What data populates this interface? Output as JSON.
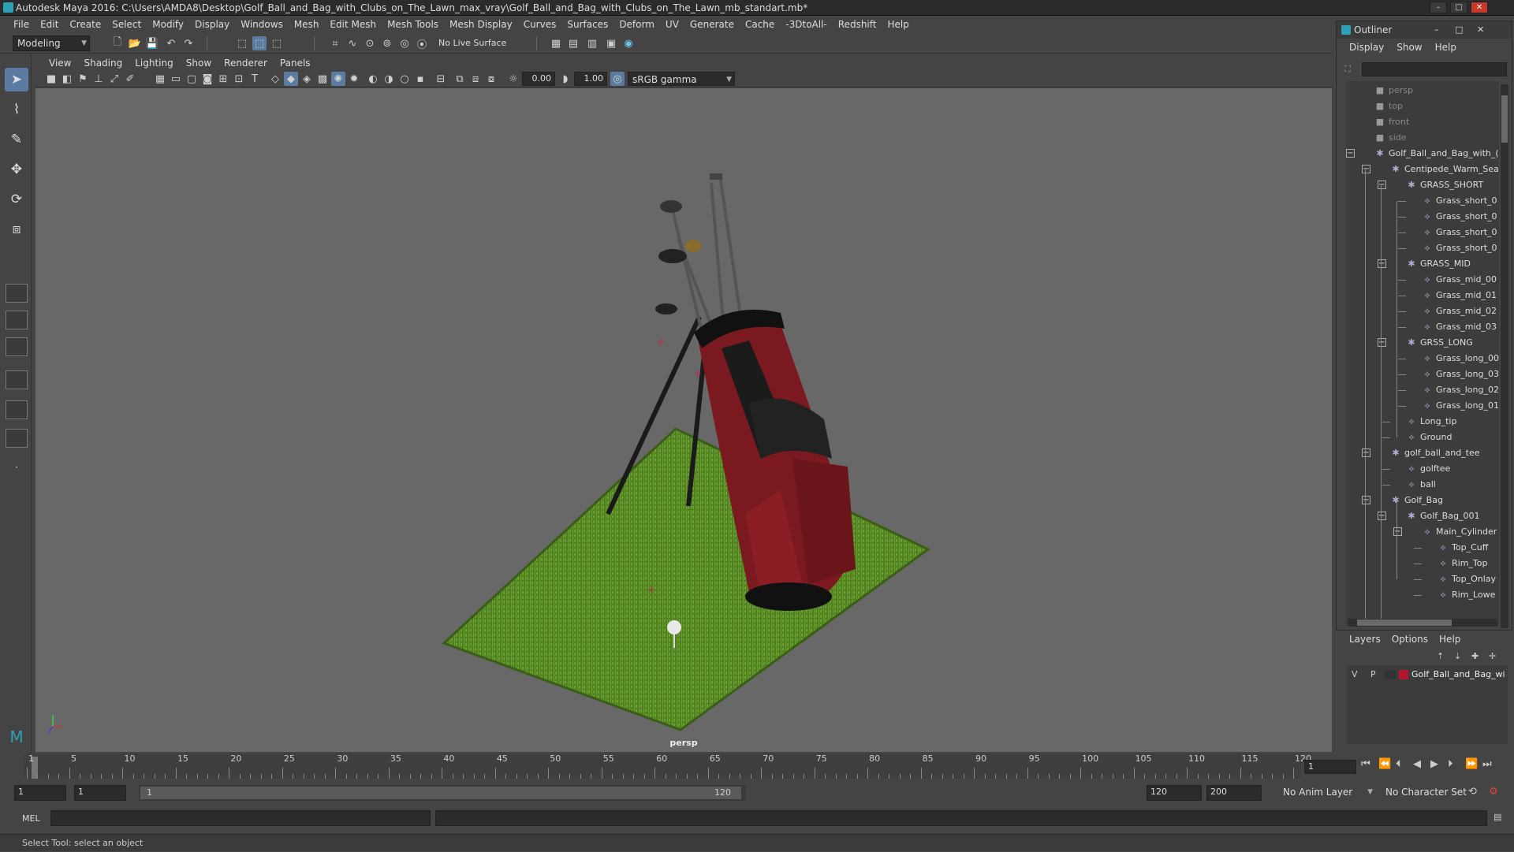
{
  "window": {
    "title": "Autodesk Maya 2016: C:\\Users\\AMDA8\\Desktop\\Golf_Ball_and_Bag_with_Clubs_on_The_Lawn_max_vray\\Golf_Ball_and_Bag_with_Clubs_on_The_Lawn_mb_standart.mb*",
    "controls": [
      "–",
      "□",
      "✕"
    ]
  },
  "menubar": [
    "File",
    "Edit",
    "Create",
    "Select",
    "Modify",
    "Display",
    "Windows",
    "Mesh",
    "Edit Mesh",
    "Mesh Tools",
    "Mesh Display",
    "Curves",
    "Surfaces",
    "Deform",
    "UV",
    "Generate",
    "Cache",
    "-3DtoAll-",
    "Redshift",
    "Help"
  ],
  "statusline": {
    "menuset": "Modeling",
    "live_surface": "No Live Surface"
  },
  "viewport": {
    "menu": [
      "View",
      "Shading",
      "Lighting",
      "Show",
      "Renderer",
      "Panels"
    ],
    "exposure": "0.00",
    "gamma": "1.00",
    "colorspace": "sRGB gamma",
    "camera_label": "persp"
  },
  "outliner": {
    "title": "Outliner",
    "menu": [
      "Display",
      "Show",
      "Help"
    ],
    "rows": [
      {
        "label": "persp",
        "depth": 0,
        "kind": "camera"
      },
      {
        "label": "top",
        "depth": 0,
        "kind": "camera"
      },
      {
        "label": "front",
        "depth": 0,
        "kind": "camera"
      },
      {
        "label": "side",
        "depth": 0,
        "kind": "camera"
      },
      {
        "label": "Golf_Ball_and_Bag_with_(",
        "depth": 0,
        "kind": "group",
        "expander": "−"
      },
      {
        "label": "Centipede_Warm_Sea",
        "depth": 1,
        "kind": "group",
        "expander": "−"
      },
      {
        "label": "GRASS_SHORT",
        "depth": 2,
        "kind": "group",
        "expander": "−"
      },
      {
        "label": "Grass_short_0",
        "depth": 3,
        "kind": "mesh"
      },
      {
        "label": "Grass_short_0",
        "depth": 3,
        "kind": "mesh"
      },
      {
        "label": "Grass_short_0",
        "depth": 3,
        "kind": "mesh"
      },
      {
        "label": "Grass_short_0",
        "depth": 3,
        "kind": "mesh"
      },
      {
        "label": "GRASS_MID",
        "depth": 2,
        "kind": "group",
        "expander": "−"
      },
      {
        "label": "Grass_mid_00",
        "depth": 3,
        "kind": "mesh"
      },
      {
        "label": "Grass_mid_01",
        "depth": 3,
        "kind": "mesh"
      },
      {
        "label": "Grass_mid_02",
        "depth": 3,
        "kind": "mesh"
      },
      {
        "label": "Grass_mid_03",
        "depth": 3,
        "kind": "mesh"
      },
      {
        "label": "GRSS_LONG",
        "depth": 2,
        "kind": "group",
        "expander": "−"
      },
      {
        "label": "Grass_long_00",
        "depth": 3,
        "kind": "mesh"
      },
      {
        "label": "Grass_long_03",
        "depth": 3,
        "kind": "mesh"
      },
      {
        "label": "Grass_long_02",
        "depth": 3,
        "kind": "mesh"
      },
      {
        "label": "Grass_long_01",
        "depth": 3,
        "kind": "mesh"
      },
      {
        "label": "Long_tip",
        "depth": 2,
        "kind": "mesh"
      },
      {
        "label": "Ground",
        "depth": 2,
        "kind": "mesh"
      },
      {
        "label": "golf_ball_and_tee",
        "depth": 1,
        "kind": "group",
        "expander": "−"
      },
      {
        "label": "golftee",
        "depth": 2,
        "kind": "mesh"
      },
      {
        "label": "ball",
        "depth": 2,
        "kind": "mesh"
      },
      {
        "label": "Golf_Bag",
        "depth": 1,
        "kind": "group",
        "expander": "−"
      },
      {
        "label": "Golf_Bag_001",
        "depth": 2,
        "kind": "group",
        "expander": "−"
      },
      {
        "label": "Main_Cylinder",
        "depth": 3,
        "kind": "mesh",
        "expander": "−"
      },
      {
        "label": "Top_Cuff",
        "depth": 4,
        "kind": "mesh"
      },
      {
        "label": "Rim_Top",
        "depth": 4,
        "kind": "mesh"
      },
      {
        "label": "Top_Onlay",
        "depth": 4,
        "kind": "mesh"
      },
      {
        "label": "Rim_Lowe",
        "depth": 4,
        "kind": "mesh"
      }
    ]
  },
  "layers": {
    "menu": [
      "Layers",
      "Options",
      "Help"
    ],
    "layer": {
      "v": "V",
      "p": "P",
      "name": "Golf_Ball_and_Bag_wi",
      "color": "#b3152c"
    }
  },
  "timeline": {
    "ticks": [
      "1",
      "5",
      "10",
      "15",
      "20",
      "25",
      "30",
      "35",
      "40",
      "45",
      "50",
      "55",
      "60",
      "65",
      "70",
      "75",
      "80",
      "85",
      "90",
      "95",
      "100",
      "105",
      "110",
      "115",
      "120"
    ],
    "current_frame": "1"
  },
  "range": {
    "start": "1",
    "anim_start": "1",
    "slider_start": "1",
    "slider_end": "120",
    "anim_end": "120",
    "end": "200",
    "anim_layer": "No Anim Layer",
    "char_set": "No Character Set"
  },
  "cmdline": {
    "label": "MEL"
  },
  "helpline": {
    "text": "Select Tool: select an object"
  }
}
